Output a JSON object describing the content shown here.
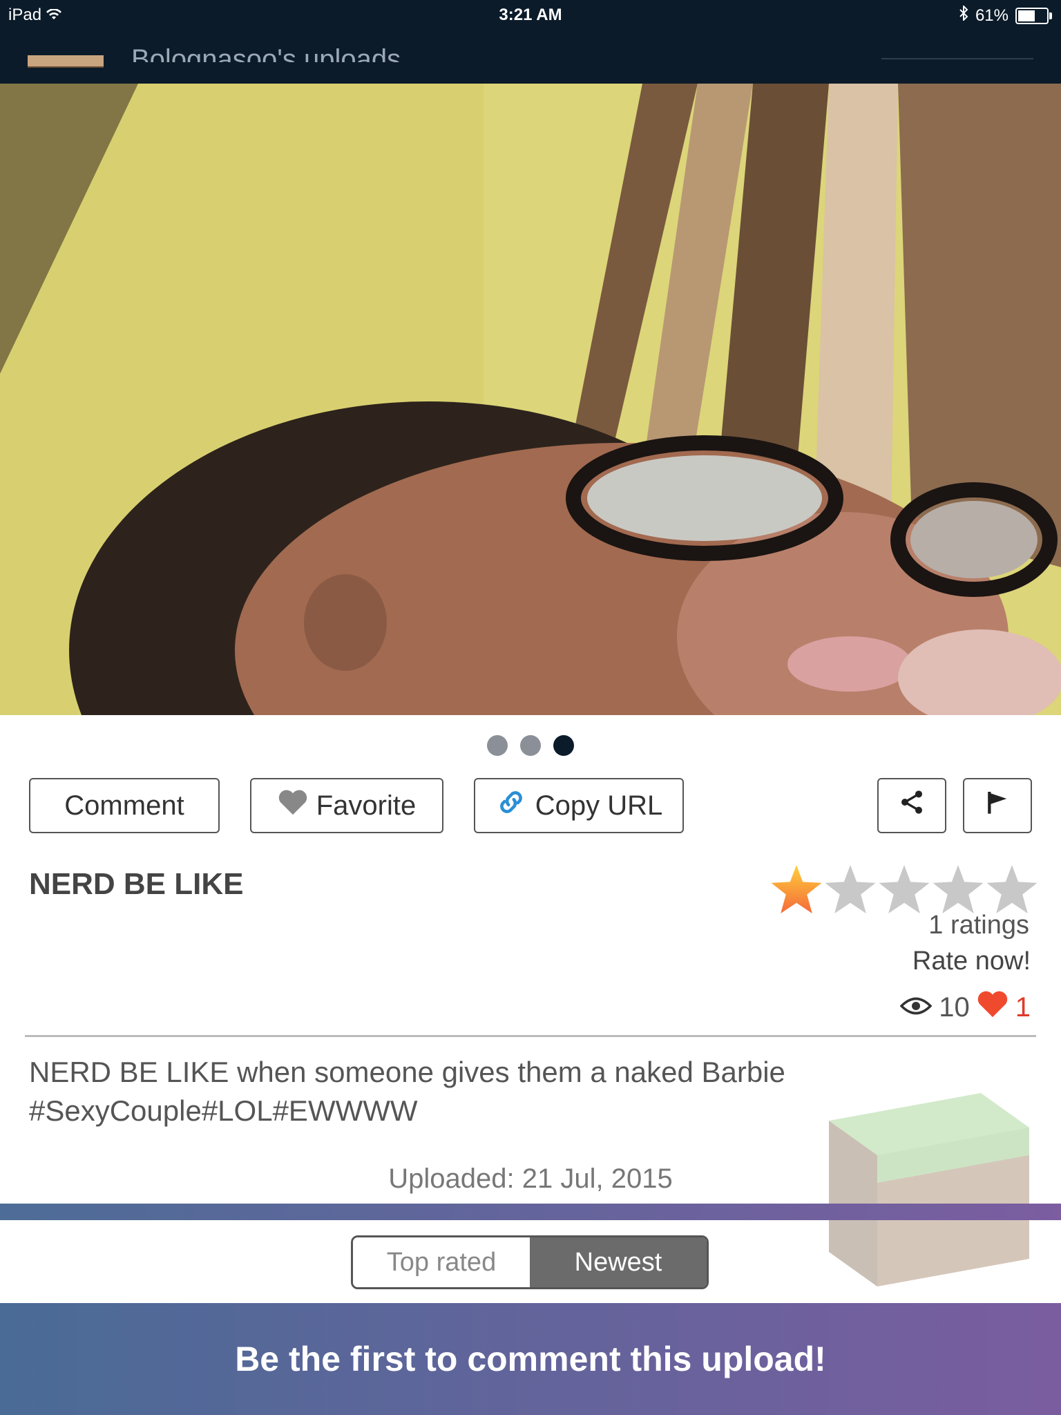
{
  "status_bar": {
    "device": "iPad",
    "time": "3:21 AM",
    "battery": "61%"
  },
  "nav": {
    "title": "Bolognasoo's uploads"
  },
  "gallery": {
    "pages": 3,
    "active_page": 3
  },
  "actions": {
    "comment": "Comment",
    "favorite": "Favorite",
    "copy_url": "Copy URL"
  },
  "upload": {
    "title": "NERD BE LIKE",
    "rating_stars": 1,
    "rating_max": 5,
    "ratings_text": "1 ratings",
    "rate_now": "Rate now!",
    "views": "10",
    "likes": "1",
    "description": "NERD BE LIKE when someone gives them a naked Barbie #SexyCouple#LOL#EWWWW",
    "uploaded": "Uploaded: 21 Jul, 2015"
  },
  "sort_tabs": {
    "top_rated": "Top rated",
    "newest": "Newest",
    "selected": "newest"
  },
  "footer": {
    "message": "Be the first to comment this upload!"
  },
  "colors": {
    "topbar": "#0b1b2a",
    "star_active": "#f2a33a",
    "star_inactive": "#c8c8c8",
    "like_red": "#e03a2a",
    "gradient_start": "#4a6b96",
    "gradient_end": "#7a5d9f"
  }
}
